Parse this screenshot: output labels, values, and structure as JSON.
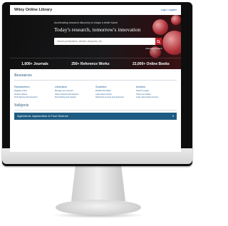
{
  "header": {
    "logo": "Wiley Online Library",
    "login": "Login / register"
  },
  "hero": {
    "tagline": "Accelerating research discovery to shape a better future",
    "headline": "Today's research, tomorrow's innovation",
    "search_placeholder": "Search publications, articles, keywords, etc.",
    "advanced_search": "Advanced Search"
  },
  "stats": [
    "1,600+ Journals",
    "250+ Reference Works",
    "22,000+ Online Books"
  ],
  "resources": {
    "title": "Resources",
    "columns": [
      {
        "head": "Researchers",
        "links": [
          "Register online",
          "Access options",
          "Find training and resources"
        ]
      },
      {
        "head": "Librarians",
        "links": [
          "Manage your account",
          "View products and solutions",
          "Find training and support"
        ]
      },
      {
        "head": "Societies",
        "links": [
          "Publish with Wiley",
          "Learn about trends",
          "Subscribe to news and resources"
        ]
      },
      {
        "head": "Authors",
        "links": [
          "Submit a paper",
          "Track your article",
          "Learn about Open Access"
        ]
      }
    ]
  },
  "subjects": {
    "title": "Subjects",
    "first": "Agriculture, Aquaculture & Food Science"
  },
  "colors": {
    "accent_red": "#c0202a",
    "link_blue": "#1a5a96",
    "subject_bar": "#1e5b82"
  }
}
